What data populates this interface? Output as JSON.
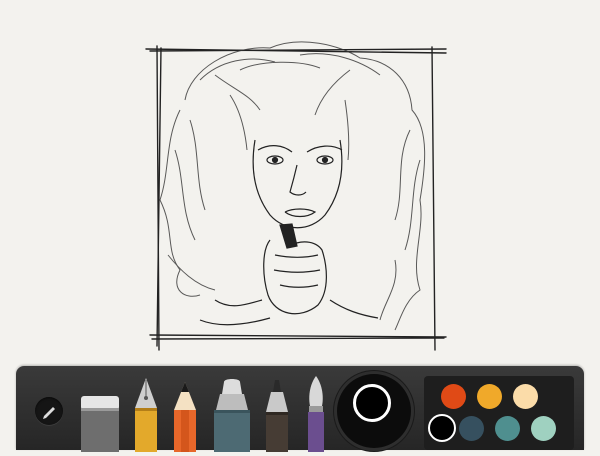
{
  "app": {
    "toolbar": {
      "tools": [
        {
          "name": "eraser",
          "icon": "eraser-icon"
        },
        {
          "name": "fountain-pen",
          "icon": "fountain-pen-icon",
          "accent": "#e3a92b"
        },
        {
          "name": "pencil",
          "icon": "pencil-icon",
          "accent": "#e8672a"
        },
        {
          "name": "marker",
          "icon": "marker-icon",
          "accent": "#4d6a73"
        },
        {
          "name": "outliner",
          "icon": "outliner-icon",
          "accent": "#463c34"
        },
        {
          "name": "brush",
          "icon": "brush-icon",
          "accent": "#6b4e8f"
        }
      ],
      "current_color": "#000000",
      "palette": [
        {
          "color": "#e04a16"
        },
        {
          "color": "#f0a92a"
        },
        {
          "color": "#fbdca9"
        },
        {
          "color": "#000000",
          "selected": true
        },
        {
          "color": "#36505f"
        },
        {
          "color": "#4f8f8f"
        },
        {
          "color": "#9fd1c0"
        }
      ]
    }
  }
}
